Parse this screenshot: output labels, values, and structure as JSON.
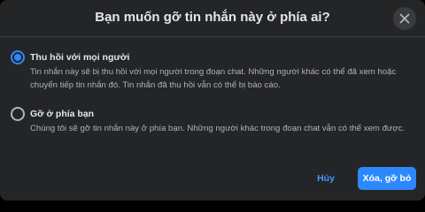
{
  "dialog": {
    "title": "Bạn muốn gỡ tin nhắn này ở phía ai?",
    "close_icon": "close-icon"
  },
  "options": [
    {
      "label": "Thu hồi với mọi người",
      "description": "Tin nhắn này sẽ bị thu hồi với mọi người trong đoạn chat. Những người khác có thể đã xem hoặc chuyển tiếp tin nhắn đó. Tin nhắn đã thu hồi vẫn có thể bị báo cáo.",
      "selected": true
    },
    {
      "label": "Gỡ ở phía bạn",
      "description": "Chúng tôi sẽ gỡ tin nhắn này ở phía bạn. Những người khác trong đoạn chat vẫn có thể xem được.",
      "selected": false
    }
  ],
  "actions": {
    "cancel_label": "Hủy",
    "confirm_label": "Xóa, gỡ bỏ"
  },
  "colors": {
    "accent": "#2d88ff",
    "dialog_bg": "#242526",
    "primary_text": "#e4e6eb",
    "secondary_text": "#b0b3b8"
  }
}
